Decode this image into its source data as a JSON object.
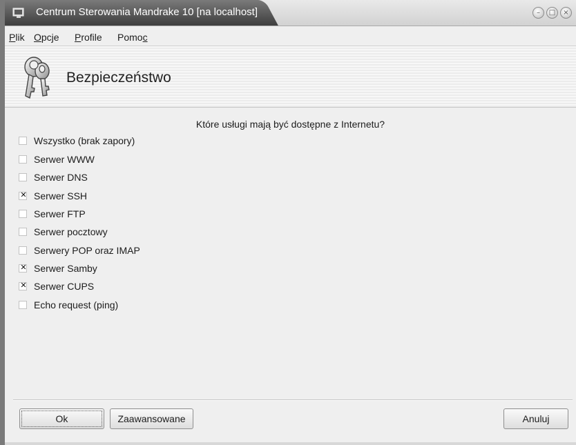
{
  "window": {
    "title": "Centrum Sterowania Mandrake 10 [na localhost]",
    "buttons": [
      "minimize-icon",
      "maximize-icon",
      "close-icon"
    ]
  },
  "menu": [
    {
      "label": "Plik"
    },
    {
      "label": "Opcje"
    },
    {
      "label": "Profile"
    },
    {
      "label": "Pomoc"
    }
  ],
  "header": {
    "title": "Bezpieczeństwo",
    "icon": "keys-icon"
  },
  "firewall": {
    "question": "Które usługi mają być dostępne z Internetu?",
    "options": [
      {
        "label": "Wszystko (brak zapory)",
        "checked": false
      },
      {
        "label": "Serwer WWW",
        "checked": false
      },
      {
        "label": "Serwer DNS",
        "checked": false
      },
      {
        "label": "Serwer SSH",
        "checked": true
      },
      {
        "label": "Serwer FTP",
        "checked": false
      },
      {
        "label": "Serwer pocztowy",
        "checked": false
      },
      {
        "label": "Serwery POP oraz IMAP",
        "checked": false
      },
      {
        "label": "Serwer Samby",
        "checked": true
      },
      {
        "label": "Serwer CUPS",
        "checked": true
      },
      {
        "label": "Echo request (ping)",
        "checked": false
      }
    ]
  },
  "footer": {
    "ok": "Ok",
    "advanced": "Zaawansowane",
    "cancel": "Anuluj"
  }
}
